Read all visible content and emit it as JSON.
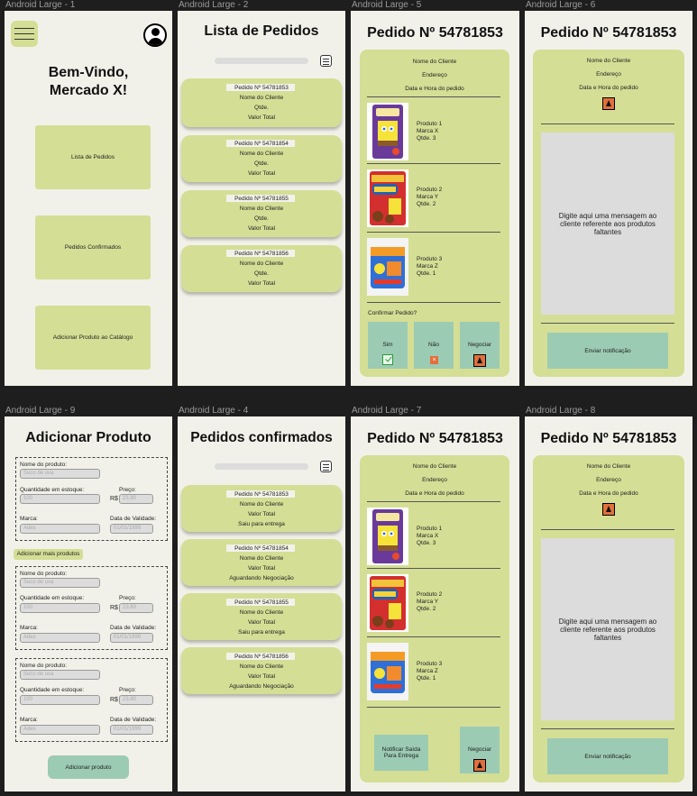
{
  "frames": {
    "f1": {
      "label": "Android Large - 1"
    },
    "f2": {
      "label": "Android Large - 2"
    },
    "f5": {
      "label": "Android Large - 5"
    },
    "f6": {
      "label": "Android Large - 6"
    },
    "f9": {
      "label": "Android Large - 9"
    },
    "f4": {
      "label": "Android Large - 4"
    },
    "f7": {
      "label": "Android Large - 7"
    },
    "f8": {
      "label": "Android Large - 8"
    }
  },
  "home": {
    "welcome_line1": "Bem-Vindo,",
    "welcome_line2": "Mercado X!",
    "buttons": [
      "Lista de Pedidos",
      "Pedidos Confirmados",
      "Adicionar Produto ao Catálogo"
    ]
  },
  "order_list": {
    "title": "Lista de Pedidos",
    "cards": [
      {
        "order": "Pedido Nº 54781853",
        "client": "Nome do Cliente",
        "qty": "Qtde.",
        "total": "Valor Total"
      },
      {
        "order": "Pedido Nº 54781854",
        "client": "Nome do Cliente",
        "qty": "Qtde.",
        "total": "Valor Total"
      },
      {
        "order": "Pedido Nº 54781855",
        "client": "Nome do Cliente",
        "qty": "Qtde.",
        "total": "Valor Total"
      },
      {
        "order": "Pedido Nº 54781856",
        "client": "Nome do Cliente",
        "qty": "Qtde.",
        "total": "Valor Total"
      }
    ]
  },
  "order_detail": {
    "title": "Pedido Nº 54781853",
    "client": "Nome do Cliente",
    "address": "Endereço",
    "datetime": "Data e Hora do pedido",
    "products": [
      {
        "name": "Produto 1",
        "brand": "Marca X",
        "qty": "Qtde. 3",
        "image": "spongebob-snack-purple"
      },
      {
        "name": "Produto 2",
        "brand": "Marca Y",
        "qty": "Qtde. 2",
        "image": "bolinho-red-pack"
      },
      {
        "name": "Produto 3",
        "brand": "Marca Z",
        "qty": "Qtde. 1",
        "image": "blue-orange-pack"
      }
    ],
    "confirm_question": "Confirmar Pedido?",
    "yes": "Sim",
    "no": "Não",
    "negotiate": "Negociar",
    "notify_exit": "Notificar Saída Para Entrega"
  },
  "message": {
    "title": "Pedido Nº 54781853",
    "client": "Nome do Cliente",
    "address": "Endereço",
    "datetime": "Data e Hora do pedido",
    "placeholder": "Digite aqui uma mensagem ao cliente referente aos produtos faltantes",
    "send": "Enviar notificação"
  },
  "add_product": {
    "title": "Adicionar Produto",
    "name_label": "Nome do produto:",
    "name_placeholder": "Suco de uva",
    "stock_label": "Quantidade em estoque:",
    "stock_placeholder": "100",
    "price_label": "Preço:",
    "currency": "R$",
    "price_placeholder": "23,80",
    "brand_label": "Marca:",
    "brand_placeholder": "Ades",
    "expiry_label": "Data de Validade:",
    "expiry_placeholder": "01/01/1999",
    "add_more": "Adicionar mais produtos",
    "submit": "Adicionar produto"
  },
  "confirmed": {
    "title": "Pedidos confirmados",
    "cards": [
      {
        "order": "Pedido Nº 54781853",
        "client": "Nome do Cliente",
        "total": "Valor Total",
        "status": "Saiu para entrega"
      },
      {
        "order": "Pedido Nº 54781854",
        "client": "Nome do Cliente",
        "total": "Valor Total",
        "status": "Aguardando Negociação"
      },
      {
        "order": "Pedido Nº 54781855",
        "client": "Nome do Cliente",
        "total": "Valor Total",
        "status": "Saiu para entrega"
      },
      {
        "order": "Pedido Nº 54781856",
        "client": "Nome do Cliente",
        "total": "Valor Total",
        "status": "Aguardando Negociação"
      }
    ]
  },
  "colors": {
    "panel": "#d5de95",
    "teal": "#9ccbb3",
    "frame_bg": "#f2f1e9",
    "canvas": "#1e1e1e"
  }
}
